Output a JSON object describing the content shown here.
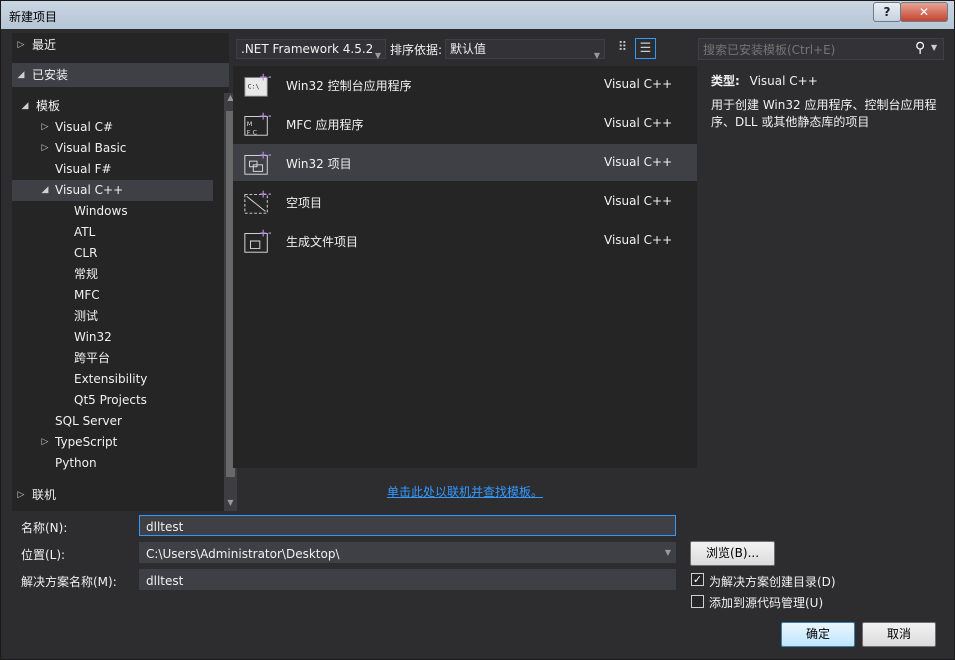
{
  "window": {
    "title": "新建项目",
    "help": "?",
    "close": "✕"
  },
  "left": {
    "recent": "最近",
    "installed": "已安装",
    "templates": "模板",
    "tree": [
      {
        "label": "Visual C#",
        "expander": "▷"
      },
      {
        "label": "Visual Basic",
        "expander": "▷"
      },
      {
        "label": "Visual F#",
        "expander": ""
      },
      {
        "label": "Visual C++",
        "expander": "◢"
      },
      {
        "label": "Windows",
        "expander": ""
      },
      {
        "label": "ATL",
        "expander": ""
      },
      {
        "label": "CLR",
        "expander": ""
      },
      {
        "label": "常规",
        "expander": ""
      },
      {
        "label": "MFC",
        "expander": ""
      },
      {
        "label": "测试",
        "expander": ""
      },
      {
        "label": "Win32",
        "expander": ""
      },
      {
        "label": "跨平台",
        "expander": ""
      },
      {
        "label": "Extensibility",
        "expander": ""
      },
      {
        "label": "Qt5 Projects",
        "expander": ""
      },
      {
        "label": "SQL Server",
        "expander": ""
      },
      {
        "label": "TypeScript",
        "expander": "▷"
      },
      {
        "label": "Python",
        "expander": ""
      }
    ],
    "online": "联机"
  },
  "toolbar": {
    "framework": ".NET Framework 4.5.2",
    "sort_label": "排序依据:",
    "sort_value": "默认值",
    "search_placeholder": "搜索已安装模板(Ctrl+E)"
  },
  "templates": [
    {
      "name": "Win32 控制台应用程序",
      "lang": "Visual C++",
      "icon": "console-app-icon"
    },
    {
      "name": "MFC 应用程序",
      "lang": "Visual C++",
      "icon": "mfc-app-icon"
    },
    {
      "name": "Win32 项目",
      "lang": "Visual C++",
      "icon": "win32-project-icon"
    },
    {
      "name": "空项目",
      "lang": "Visual C++",
      "icon": "empty-project-icon"
    },
    {
      "name": "生成文件项目",
      "lang": "Visual C++",
      "icon": "makefile-project-icon"
    }
  ],
  "details": {
    "type_label": "类型:",
    "type_value": "Visual C++",
    "description": "用于创建 Win32 应用程序、控制台应用程序、DLL 或其他静态库的项目"
  },
  "online_link": "单击此处以联机并查找模板。",
  "form": {
    "name_label": "名称(N):",
    "name_value": "dlltest",
    "location_label": "位置(L):",
    "location_value": "C:\\Users\\Administrator\\Desktop\\",
    "solution_label": "解决方案名称(M):",
    "solution_value": "dlltest",
    "browse": "浏览(B)...",
    "create_dir": "为解决方案创建目录(D)",
    "add_source_control": "添加到源代码管理(U)"
  },
  "buttons": {
    "ok": "确定",
    "cancel": "取消"
  },
  "colors": {
    "selection": "#3f3f46",
    "accent": "#3399ff",
    "pane": "#252526",
    "window": "#2d2d30"
  }
}
